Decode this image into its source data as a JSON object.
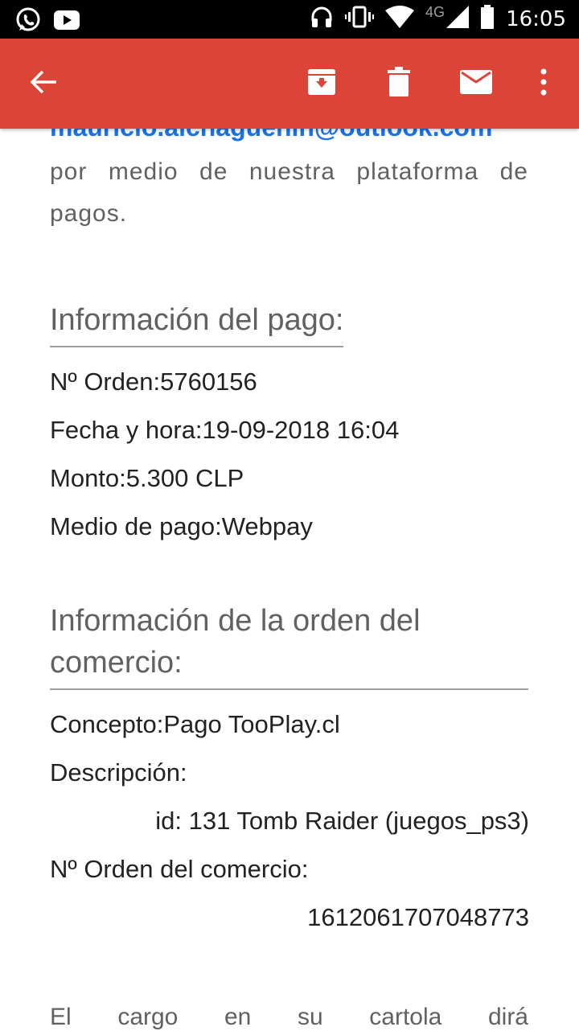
{
  "status_bar": {
    "time": "16:05",
    "network": "4G",
    "left_icons": [
      "whatsapp-icon",
      "youtube-icon"
    ],
    "right_icons": [
      "headphones-icon",
      "vibrate-icon",
      "wifi-icon",
      "signal-icon",
      "battery-icon"
    ]
  },
  "app_bar": {
    "color": "#db4437",
    "actions": [
      "back-arrow-icon",
      "archive-icon",
      "delete-icon",
      "mark-unread-icon",
      "more-vert-icon"
    ]
  },
  "email": {
    "address": "mauricio.aichaguenin@outlook.com",
    "intro": "por medio de nuestra plataforma de pagos.",
    "payment_section": {
      "title": "Información del pago:",
      "order_label": "Nº Orden:",
      "order_value": "5760156",
      "date_label": "Fecha y hora:",
      "date_value": "19-09-2018 16:04",
      "amount_label": "Monto:",
      "amount_value": "5.300 CLP",
      "method_label": "Medio de pago:",
      "method_value": "Webpay"
    },
    "order_section": {
      "title": "Información de la orden del comercio:",
      "concept_label": "Concepto:",
      "concept_value": "Pago TooPlay.cl",
      "description_label": "Descripción:",
      "description_value": "id: 131 Tomb Raider (juegos_ps3)",
      "merchant_order_label": "Nº Orden del comercio:",
      "merchant_order_value": "1612061707048773"
    },
    "footer_words": [
      "El",
      "cargo",
      "en",
      "su",
      "cartola",
      "dirá"
    ]
  }
}
